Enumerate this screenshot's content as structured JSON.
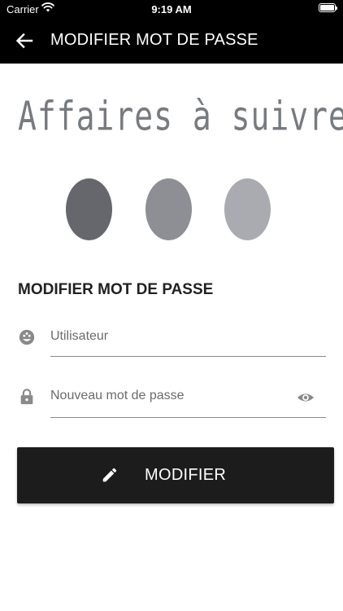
{
  "status_bar": {
    "carrier": "Carrier",
    "time": "9:19 AM"
  },
  "app_bar": {
    "title": "MODIFIER MOT DE PASSE",
    "back_icon": "arrow-left-icon"
  },
  "logo": {
    "text": "Affaires à suivre",
    "dot_colors": [
      "#66676c",
      "#8e8f94",
      "#aaabb0"
    ]
  },
  "form": {
    "title": "MODIFIER MOT DE PASSE",
    "username": {
      "icon": "user-badge-icon",
      "placeholder": "Utilisateur",
      "value": ""
    },
    "password": {
      "icon": "lock-icon",
      "placeholder": "Nouveau mot de passe",
      "value": "",
      "toggle_icon": "eye-icon"
    },
    "submit": {
      "label": "MODIFIER",
      "icon": "pencil-icon"
    }
  },
  "colors": {
    "app_bar": "#000000",
    "button": "#1c1c1c",
    "icon_gray": "#8a8a8a"
  }
}
